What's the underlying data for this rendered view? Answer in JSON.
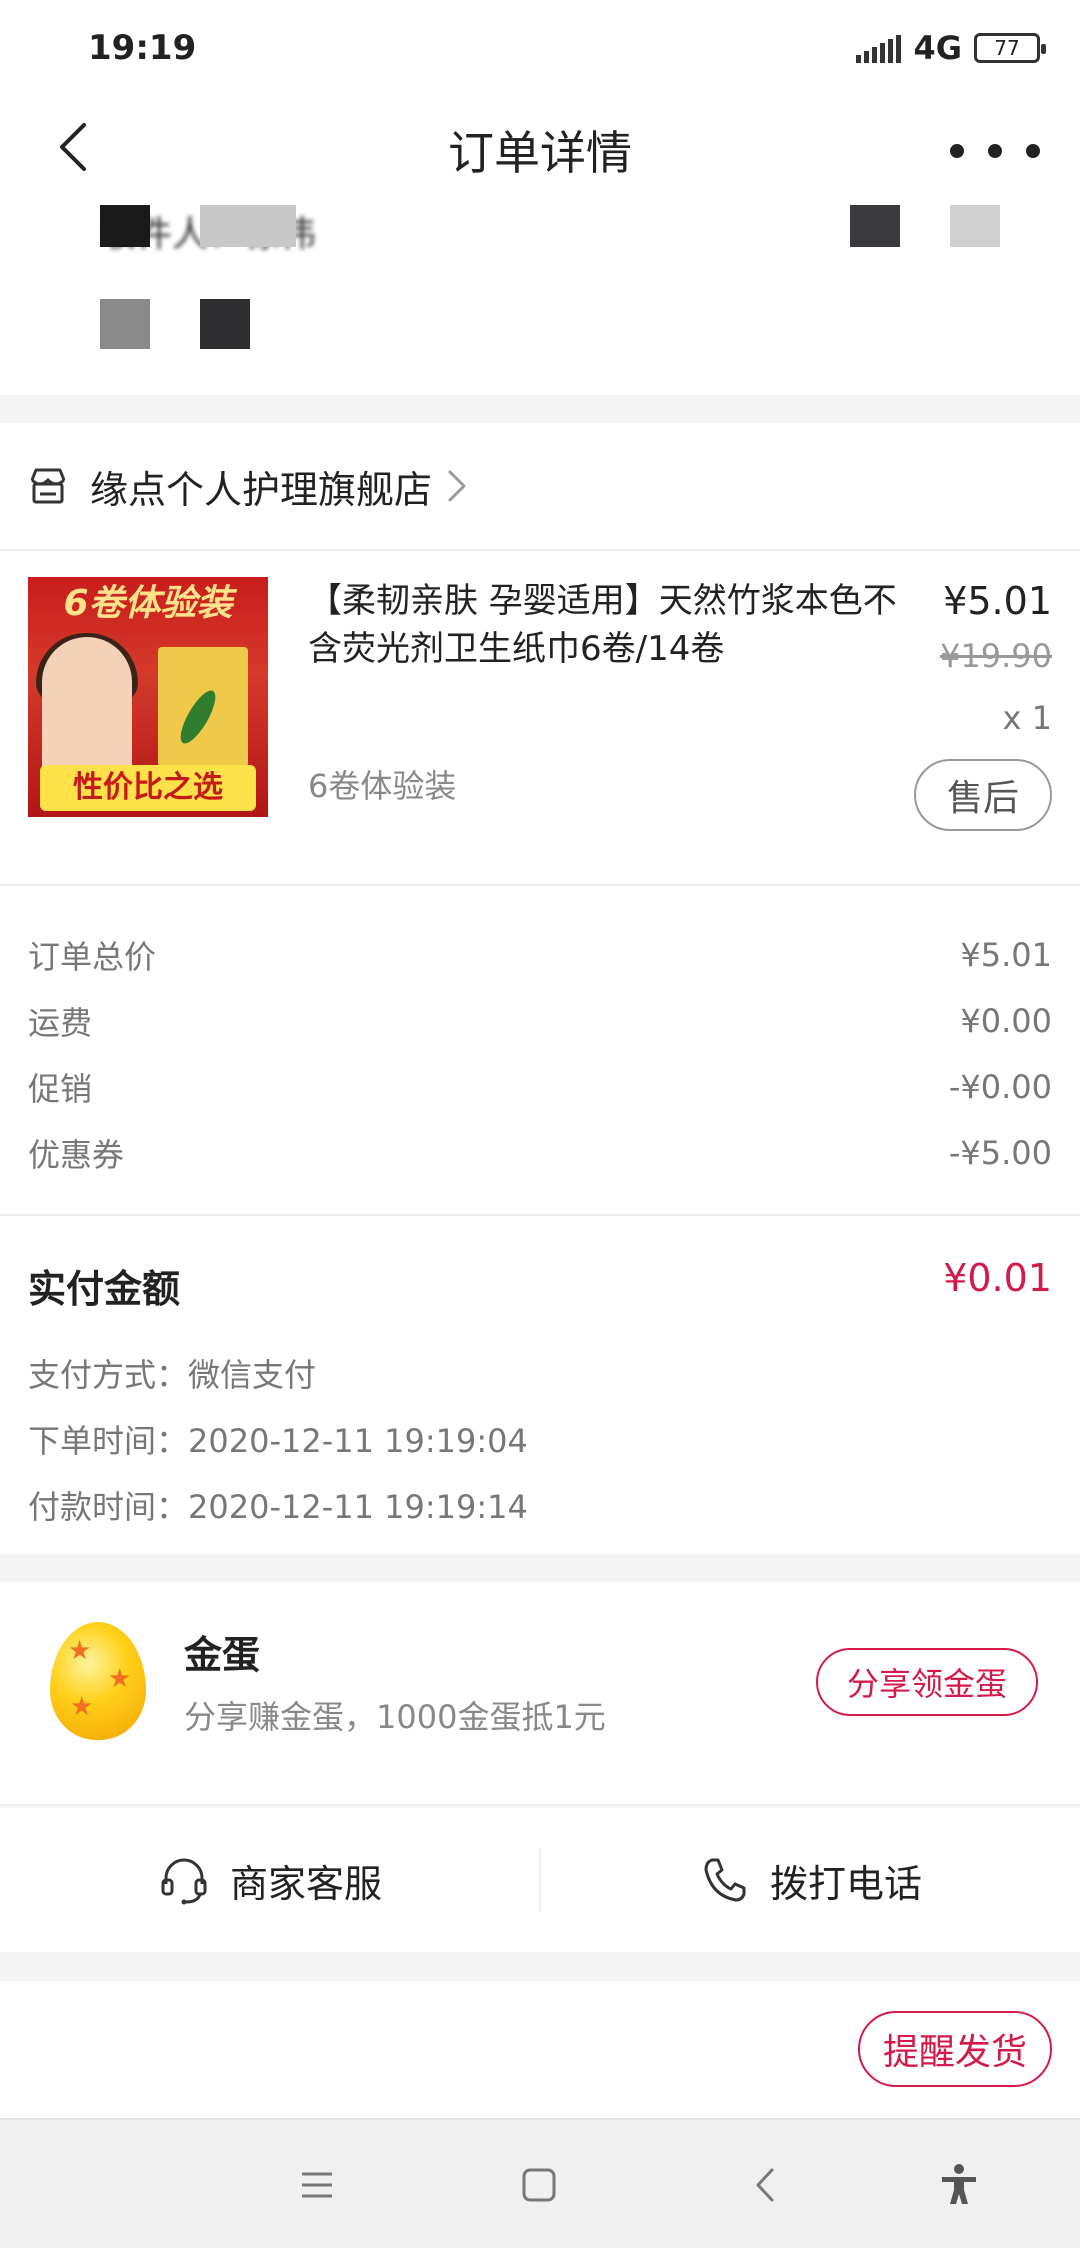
{
  "status_bar": {
    "time": "19:19",
    "network": "4G",
    "battery": "77"
  },
  "navbar": {
    "title": "订单详情"
  },
  "address": {
    "recipient_label": "收件人：徐伟"
  },
  "shop": {
    "name": "缘点个人护理旗舰店"
  },
  "product": {
    "title": "【柔韧亲肤 孕婴适用】天然竹浆本色不含荧光剂卫生纸巾6卷/14卷",
    "image_top_text": "6卷体验装",
    "image_bottom_text": "性价比之选",
    "spec": "6卷体验装",
    "price": "¥5.01",
    "original_price": "¥19.90",
    "quantity": "x 1",
    "after_sale_label": "售后"
  },
  "totals": [
    {
      "label": "订单总价",
      "value": "¥5.01"
    },
    {
      "label": "运费",
      "value": "¥0.00"
    },
    {
      "label": "促销",
      "value": "-¥0.00"
    },
    {
      "label": "优惠券",
      "value": "-¥5.00"
    }
  ],
  "payment": {
    "paid_label": "实付金额",
    "paid_value": "¥0.01",
    "method": "支付方式：微信支付",
    "order_time": "下单时间：2020-12-11 19:19:04",
    "pay_time": "付款时间：2020-12-11 19:19:14"
  },
  "golden_egg": {
    "title": "金蛋",
    "subtitle": "分享赚金蛋，1000金蛋抵1元",
    "button": "分享领金蛋"
  },
  "contact": {
    "service": "商家客服",
    "call": "拨打电话"
  },
  "actions": {
    "remind_label": "提醒发货"
  },
  "colors": {
    "accent": "#d21b4b",
    "muted": "#777777"
  }
}
